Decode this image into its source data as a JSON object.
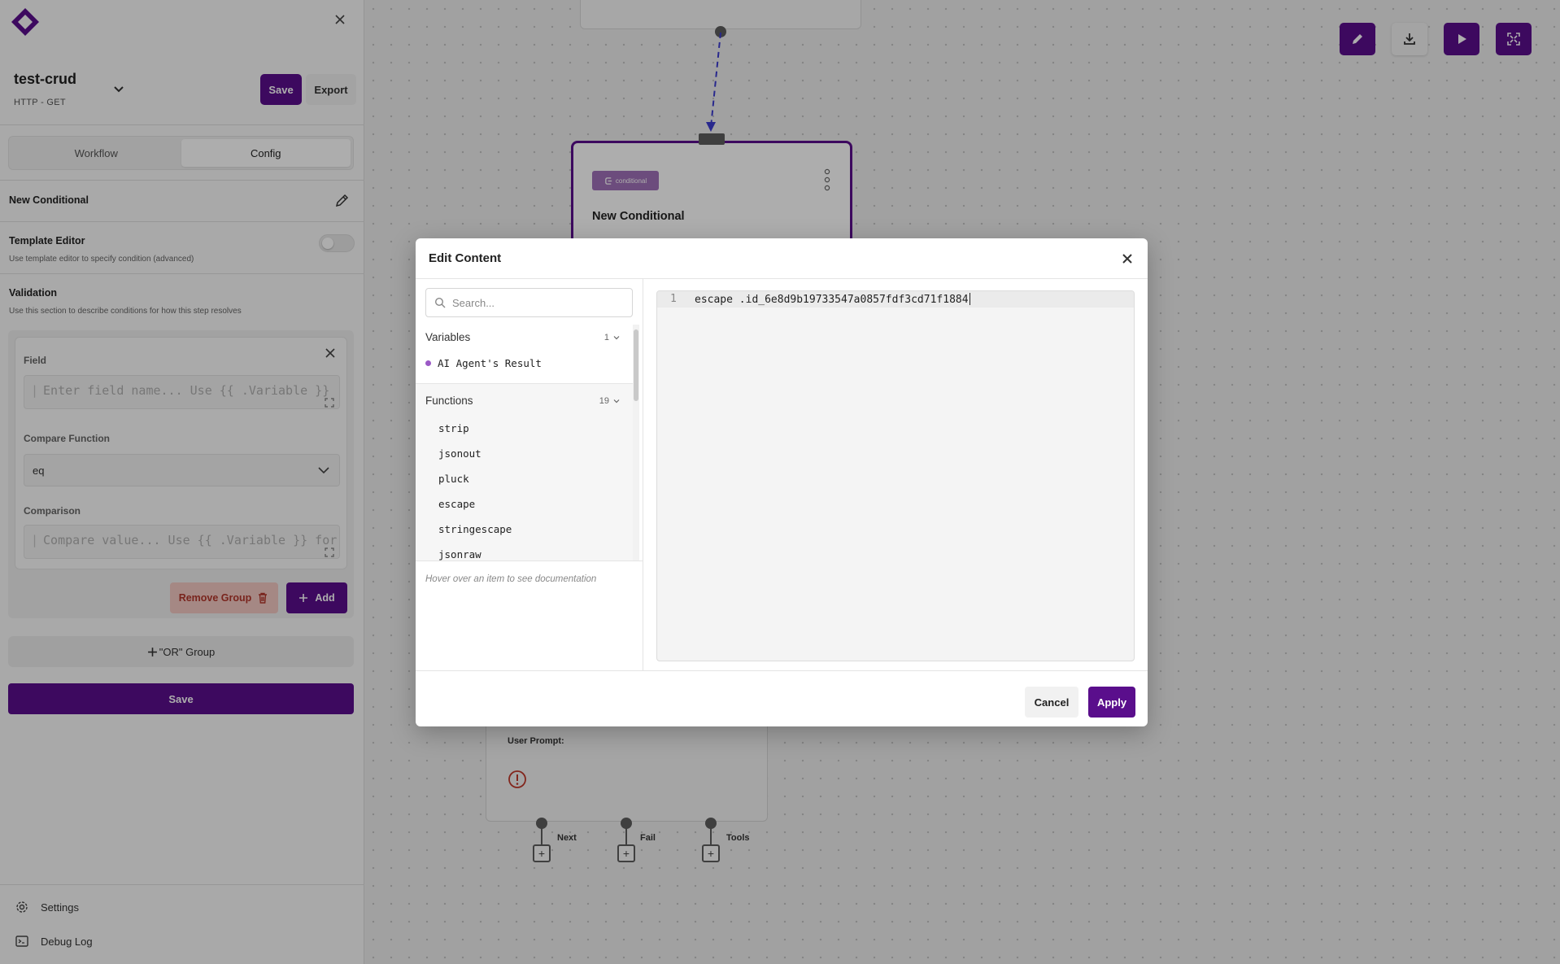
{
  "sidebar": {
    "workflow_name": "test-crud",
    "workflow_subtitle": "HTTP - GET",
    "save_label": "Save",
    "export_label": "Export",
    "tabs": [
      {
        "label": "Workflow",
        "active": false
      },
      {
        "label": "Config",
        "active": true
      }
    ],
    "step_name": "New Conditional",
    "template_editor": {
      "title": "Template Editor",
      "description": "Use template editor to specify condition (advanced)",
      "enabled": false
    },
    "validation": {
      "title": "Validation",
      "description": "Use this section to describe conditions for how this step resolves"
    },
    "group": {
      "field_label": "Field",
      "field_placeholder": "Enter field name... Use {{ .Variable }}",
      "compare_label": "Compare Function",
      "compare_value": "eq",
      "comparison_label": "Comparison",
      "comparison_placeholder": "Compare value... Use {{ .Variable }} for",
      "remove_label": "Remove Group",
      "add_label": "Add"
    },
    "or_group_label": "\"OR\" Group",
    "save_main_label": "Save",
    "footer": [
      {
        "label": "Settings",
        "icon": "gear-icon"
      },
      {
        "label": "Debug Log",
        "icon": "terminal-icon"
      }
    ]
  },
  "canvas": {
    "conditional_node": {
      "badge": "conditional",
      "title": "New Conditional"
    },
    "agent_node": {
      "prompt_label": "User Prompt:"
    },
    "ports": [
      "Next",
      "Fail",
      "Tools"
    ]
  },
  "modal": {
    "title": "Edit Content",
    "search_placeholder": "Search...",
    "variables": {
      "label": "Variables",
      "count": "1",
      "items": [
        "AI Agent's Result"
      ]
    },
    "functions": {
      "label": "Functions",
      "count": "19",
      "items": [
        "strip",
        "jsonout",
        "pluck",
        "escape",
        "stringescape",
        "jsonraw"
      ]
    },
    "hover_hint": "Hover over an item to see documentation",
    "editor": {
      "line_number": "1",
      "code": "escape .id_6e8d9b19733547a0857fdf3cd71f1884"
    },
    "cancel_label": "Cancel",
    "apply_label": "Apply"
  },
  "colors": {
    "brand": "#5a0e8c",
    "danger_bg": "#f3c9c3",
    "danger_text": "#b3362c",
    "variable_dot": "#9b59c6"
  }
}
